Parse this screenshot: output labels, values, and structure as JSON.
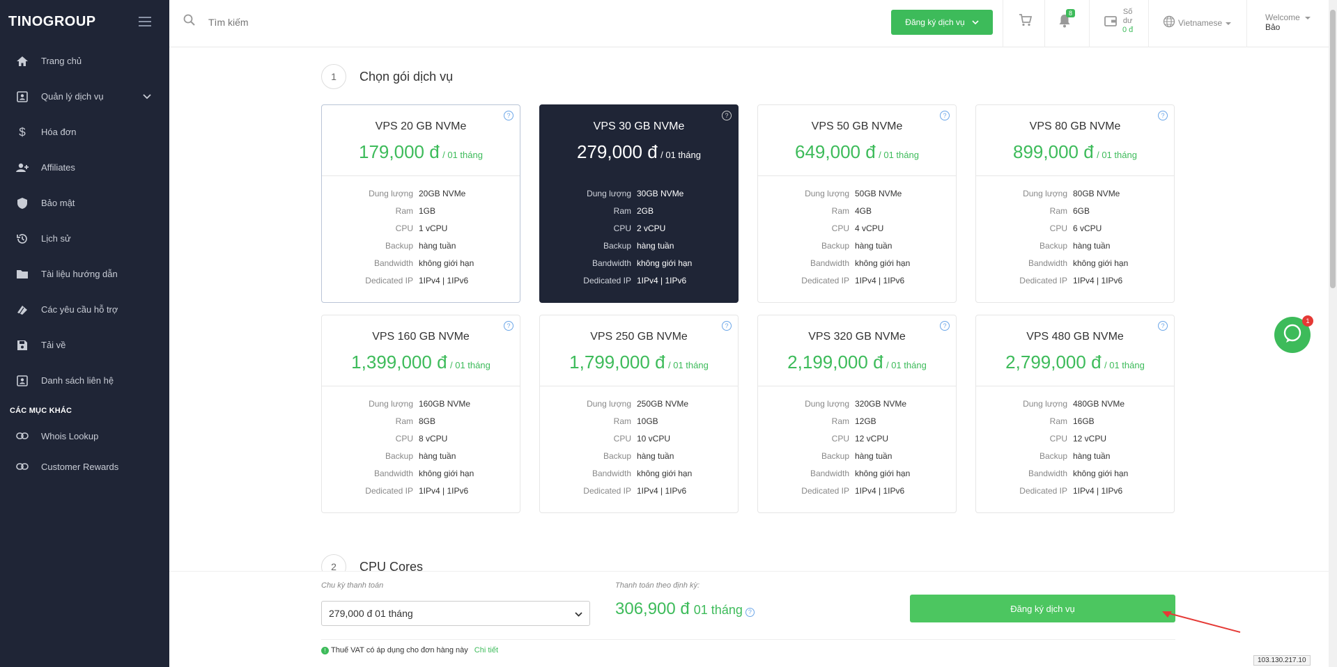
{
  "brand": {
    "logo": "TINOGROUP"
  },
  "sidebar": {
    "items": [
      {
        "label": "Trang chủ",
        "icon": "home-icon"
      },
      {
        "label": "Quản lý dịch vụ",
        "icon": "account-box-icon"
      },
      {
        "label": "Hóa đơn",
        "icon": "dollar-icon"
      },
      {
        "label": "Affiliates",
        "icon": "user-plus-icon"
      },
      {
        "label": "Bảo mật",
        "icon": "shield-icon"
      },
      {
        "label": "Lịch sử",
        "icon": "history-icon"
      },
      {
        "label": "Tài liệu hướng dẫn",
        "icon": "folder-icon"
      },
      {
        "label": "Các yêu cầu hỗ trợ",
        "icon": "tickets-icon"
      },
      {
        "label": "Tải về",
        "icon": "save-icon"
      },
      {
        "label": "Danh sách liên hệ",
        "icon": "contact-icon"
      }
    ],
    "section_title": "CÁC MỤC KHÁC",
    "other_items": [
      {
        "label": "Whois Lookup",
        "icon": "link-icon"
      },
      {
        "label": "Customer Rewards",
        "icon": "link-icon"
      }
    ]
  },
  "topbar": {
    "search_placeholder": "Tìm kiếm",
    "register_button": "Đăng ký dịch vụ",
    "notification_count": "8",
    "balance_label_1": "Số",
    "balance_label_2": "dư",
    "balance_amount": "0 đ",
    "language": "Vietnamese",
    "welcome": "Welcome",
    "username": "Bảo"
  },
  "step1": {
    "num": "1",
    "title": "Chọn gói dịch vụ"
  },
  "step2": {
    "num": "2",
    "title": "CPU Cores"
  },
  "spec_labels": [
    "Dung lượng",
    "Ram",
    "CPU",
    "Backup",
    "Bandwidth",
    "Dedicated IP"
  ],
  "plans": [
    {
      "name": "VPS 20 GB NVMe",
      "price": "179,000 đ",
      "period": "/ 01 tháng",
      "specs": [
        "20GB NVMe",
        "1GB",
        "1 vCPU",
        "hàng tuần",
        "không giới hạn",
        "1IPv4 | 1IPv6"
      ]
    },
    {
      "name": "VPS 30 GB NVMe",
      "price": "279,000 đ",
      "period": "/ 01 tháng",
      "specs": [
        "30GB NVMe",
        "2GB",
        "2 vCPU",
        "hàng tuần",
        "không giới hạn",
        "1IPv4 | 1IPv6"
      ]
    },
    {
      "name": "VPS 50 GB NVMe",
      "price": "649,000 đ",
      "period": "/ 01 tháng",
      "specs": [
        "50GB NVMe",
        "4GB",
        "4 vCPU",
        "hàng tuần",
        "không giới hạn",
        "1IPv4 | 1IPv6"
      ]
    },
    {
      "name": "VPS 80 GB NVMe",
      "price": "899,000 đ",
      "period": "/ 01 tháng",
      "specs": [
        "80GB NVMe",
        "6GB",
        "6 vCPU",
        "hàng tuần",
        "không giới hạn",
        "1IPv4 | 1IPv6"
      ]
    },
    {
      "name": "VPS 160 GB NVMe",
      "price": "1,399,000 đ",
      "period": "/ 01 tháng",
      "specs": [
        "160GB NVMe",
        "8GB",
        "8 vCPU",
        "hàng tuần",
        "không giới hạn",
        "1IPv4 | 1IPv6"
      ]
    },
    {
      "name": "VPS 250 GB NVMe",
      "price": "1,799,000 đ",
      "period": "/ 01 tháng",
      "specs": [
        "250GB NVMe",
        "10GB",
        "10 vCPU",
        "hàng tuần",
        "không giới hạn",
        "1IPv4 | 1IPv6"
      ]
    },
    {
      "name": "VPS 320 GB NVMe",
      "price": "2,199,000 đ",
      "period": "/ 01 tháng",
      "specs": [
        "320GB NVMe",
        "12GB",
        "12 vCPU",
        "hàng tuần",
        "không giới hạn",
        "1IPv4 | 1IPv6"
      ]
    },
    {
      "name": "VPS 480 GB NVMe",
      "price": "2,799,000 đ",
      "period": "/ 01 tháng",
      "specs": [
        "480GB NVMe",
        "16GB",
        "12 vCPU",
        "hàng tuần",
        "không giới hạn",
        "1IPv4 | 1IPv6"
      ]
    }
  ],
  "selected_plan": "VPS 30 GB NVMe",
  "bottom": {
    "cycle_label": "Chu kỳ thanh toán",
    "cycle_value": "279,000 đ 01 tháng",
    "periodic_label": "Thanh toán theo định kỳ:",
    "total_price": "306,900 đ",
    "total_period": "01 tháng",
    "register_button": "Đăng ký dịch vụ",
    "vat_note": "Thuế VAT có áp dụng cho đơn hàng này",
    "vat_link": "Chi tiết"
  },
  "chat": {
    "badge": "1"
  },
  "ip_address": "103.130.217.10",
  "colors": {
    "sidebar_bg": "#1f2536",
    "accent_green": "#3dbb5a",
    "selected_card": "#1f2536"
  }
}
